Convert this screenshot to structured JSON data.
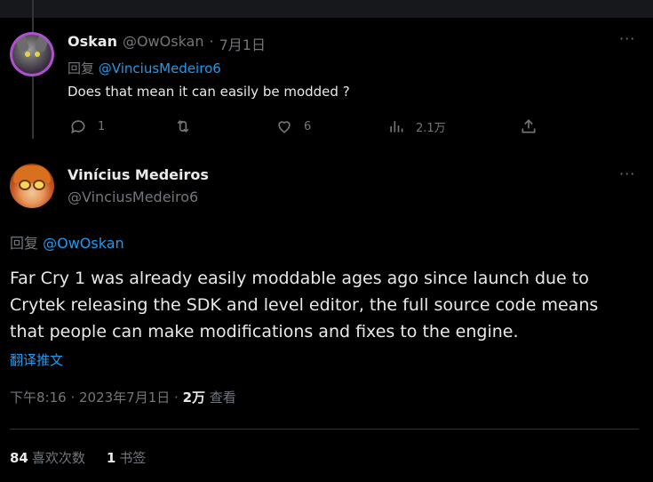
{
  "reply_tweet": {
    "name": "Oskan",
    "handle": "@OwOskan",
    "date": "7月1日",
    "reply_prefix": "回复",
    "reply_to": "@VinciusMedeiro6",
    "text": "Does that mean it can easily be modded ?",
    "more": "···",
    "actions": {
      "reply_count": "1",
      "retweet_count": "",
      "like_count": "6",
      "view_count": "2.1万"
    }
  },
  "main_tweet": {
    "name": "Vinícius Medeiros",
    "handle": "@VinciusMedeiro6",
    "more": "···",
    "reply_prefix": "回复",
    "reply_to": "@OwOskan",
    "text": "Far Cry 1 was already easily moddable ages ago since launch due to Crytek releasing the SDK and level editor, the full source code means that people can make modifications and fixes to the engine.",
    "translate": "翻译推文",
    "timestamp": "下午8:16 · 2023年7月1日 · ",
    "views_count": "2万",
    "views_label": " 查看",
    "likes_count": "84",
    "likes_label": "喜欢次数",
    "bookmarks_count": "1",
    "bookmarks_label": "书签"
  },
  "colors": {
    "background": "#000000",
    "text": "#e7e9ea",
    "muted": "#71767b",
    "link": "#1d9bf0",
    "divider": "#2f3336"
  },
  "icons": [
    "reply-icon",
    "retweet-icon",
    "like-icon",
    "views-icon",
    "share-icon",
    "more-icon"
  ]
}
